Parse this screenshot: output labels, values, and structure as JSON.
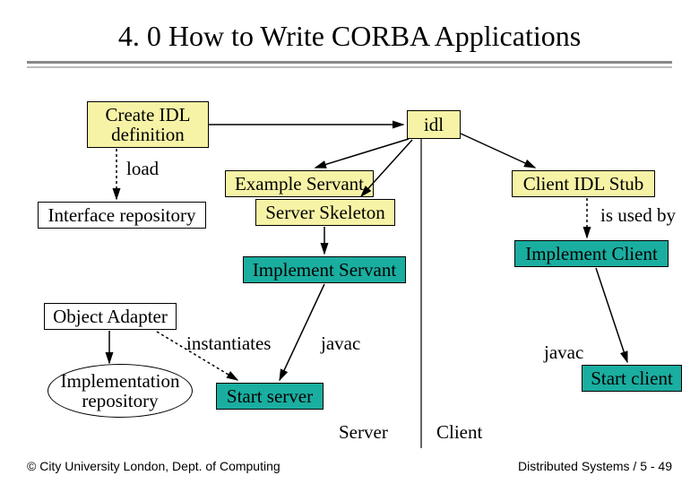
{
  "title": "4. 0 How to Write CORBA Applications",
  "boxes": {
    "create_idl": "Create IDL\ndefinition",
    "idl": "idl",
    "example_servant": "Example Servant",
    "server_skeleton": "Server Skeleton",
    "client_idl_stub": "Client IDL Stub",
    "interface_repository": "Interface repository",
    "implement_servant": "Implement Servant",
    "implement_client": "Implement Client",
    "object_adapter": "Object Adapter",
    "start_server": "Start server",
    "start_client": "Start client"
  },
  "ellipses": {
    "implementation_repository": "Implementation\nrepository"
  },
  "labels": {
    "load": "load",
    "is_used_by": "is used by",
    "instantiates": "instantiates",
    "javac1": "javac",
    "javac2": "javac",
    "server": "Server",
    "client": "Client"
  },
  "footer": {
    "left": "© City University London, Dept. of Computing",
    "right": "Distributed Systems / 5 - 49"
  }
}
